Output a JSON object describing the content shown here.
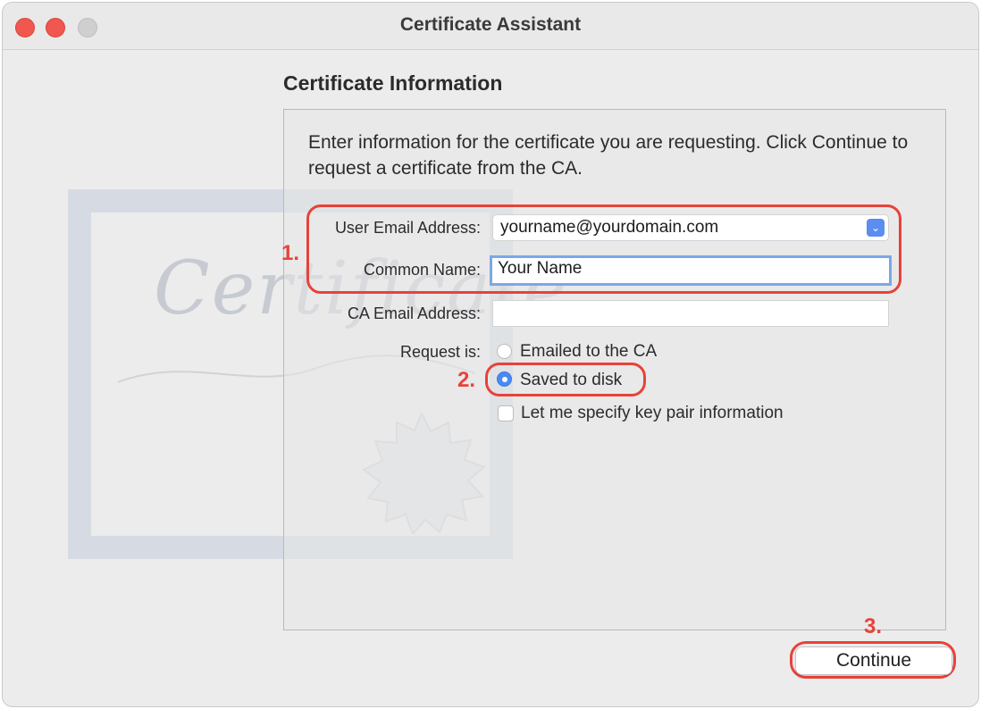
{
  "window": {
    "title": "Certificate Assistant"
  },
  "background_art": {
    "text": "Certificate"
  },
  "section": {
    "heading": "Certificate Information",
    "description": "Enter information for the certificate you are requesting. Click Continue to request a certificate from the CA."
  },
  "form": {
    "user_email_label": "User Email Address:",
    "user_email_value": "yourname@yourdomain.com",
    "common_name_label": "Common Name:",
    "common_name_value": "Your Name",
    "ca_email_label": "CA Email Address:",
    "ca_email_value": "",
    "request_label": "Request is:",
    "request_options": [
      {
        "label": "Emailed to the CA",
        "selected": false
      },
      {
        "label": "Saved to disk",
        "selected": true
      }
    ],
    "key_pair_checkbox_label": "Let me specify key pair information",
    "key_pair_checked": false
  },
  "annotations": {
    "marker_1": "1.",
    "marker_2": "2.",
    "marker_3": "3.",
    "color": "#e8423a"
  },
  "footer": {
    "continue_label": "Continue"
  },
  "icons": {
    "select_arrow": "chevron-updown-icon"
  }
}
